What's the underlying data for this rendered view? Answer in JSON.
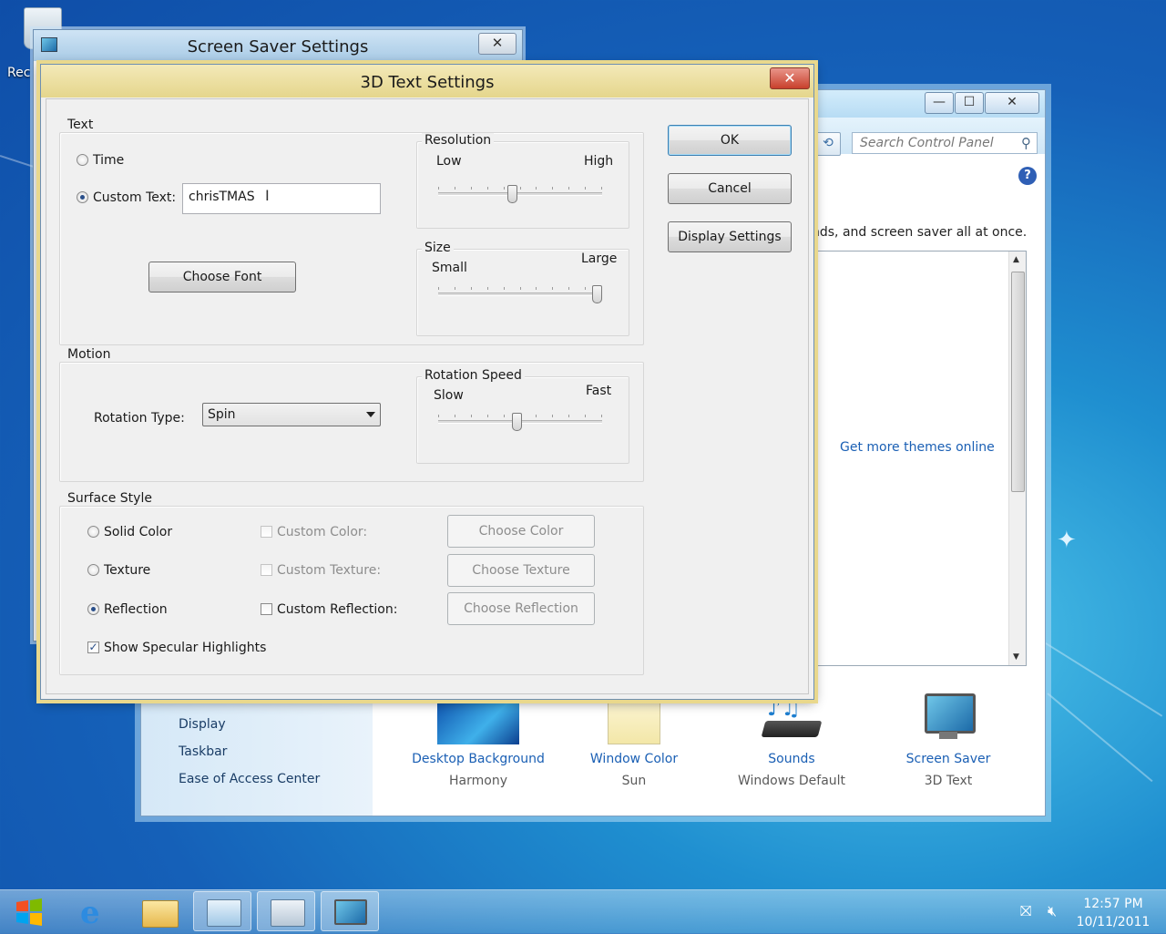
{
  "desktop": {
    "recycle_bin_label": "Rec"
  },
  "control_panel": {
    "search_placeholder": "Search Control Panel",
    "description": "nds, and screen saver all at once.",
    "get_more_link": "Get more themes online",
    "left_links": [
      "Display",
      "Taskbar",
      "Ease of Access Center"
    ],
    "bottom_items": [
      {
        "label": "Desktop Background",
        "sub": "Harmony"
      },
      {
        "label": "Window Color",
        "sub": "Sun"
      },
      {
        "label": "Sounds",
        "sub": "Windows Default"
      },
      {
        "label": "Screen Saver",
        "sub": "3D Text"
      }
    ],
    "window_buttons": {
      "minimize": "—",
      "maximize": "☐",
      "close": "✕"
    },
    "help_glyph": "?"
  },
  "screen_saver": {
    "title": "Screen Saver Settings",
    "close_glyph": "✕"
  },
  "dialog": {
    "title": "3D Text Settings",
    "close_glyph": "✕",
    "text_group": {
      "title": "Text",
      "time_label": "Time",
      "custom_label": "Custom Text:",
      "custom_value": "chrisTMAS",
      "choose_font": "Choose Font",
      "selected": "custom"
    },
    "resolution": {
      "title": "Resolution",
      "low": "Low",
      "high": "High",
      "value": 0.45
    },
    "size": {
      "title": "Size",
      "small": "Small",
      "large": "Large",
      "value": 1.0
    },
    "motion_group": {
      "title": "Motion",
      "rotation_type_label": "Rotation Type:",
      "rotation_type_value": "Spin"
    },
    "rotation_speed": {
      "title": "Rotation Speed",
      "slow": "Slow",
      "fast": "Fast",
      "value": 0.48
    },
    "surface_group": {
      "title": "Surface Style",
      "solid_color": "Solid Color",
      "texture": "Texture",
      "reflection": "Reflection",
      "custom_color": "Custom Color:",
      "custom_texture": "Custom Texture:",
      "custom_reflection": "Custom Reflection:",
      "choose_color": "Choose Color",
      "choose_texture": "Choose Texture",
      "choose_reflection": "Choose Reflection",
      "specular": "Show Specular Highlights",
      "selected": "reflection",
      "specular_checked": true
    },
    "buttons": {
      "ok": "OK",
      "cancel": "Cancel",
      "display_settings": "Display Settings"
    }
  },
  "taskbar": {
    "time": "12:57 PM",
    "date": "10/11/2011"
  },
  "colors": {
    "link": "#1a5fb4",
    "dialog_title": "#e5d68c",
    "close_red": "#c8402c"
  }
}
